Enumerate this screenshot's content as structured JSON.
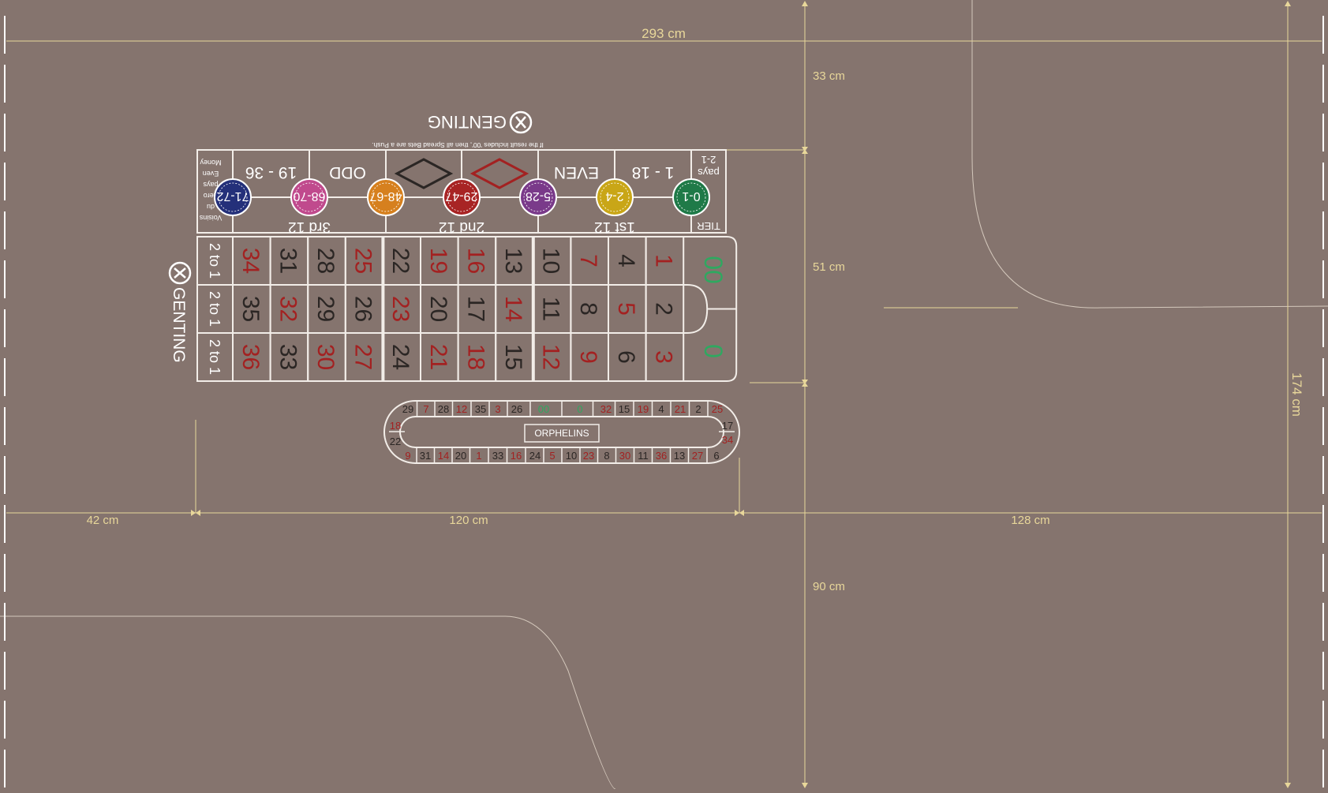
{
  "colors": {
    "felt": "#85746e",
    "line": "#f2ede8",
    "dim": "#e8d79a",
    "red": "#a32121",
    "black": "#2b2624",
    "green": "#2fa860"
  },
  "dimensions": {
    "width_total": "293 cm",
    "height_total": "174 cm",
    "top_margin": "33 cm",
    "layout_height": "51 cm",
    "bottom_margin": "90 cm",
    "left_margin": "42 cm",
    "layout_width": "120 cm",
    "right_margin": "128 cm"
  },
  "brand": {
    "name": "GENTING",
    "logo_icon": "genting-logo-icon",
    "notice": "If the result includes '00', then all Spread Bets are a Push."
  },
  "columns": {
    "label": "2 to 1",
    "rows": [
      [
        34,
        31,
        28,
        25,
        22,
        19,
        16,
        13,
        10,
        7,
        4,
        1
      ],
      [
        35,
        32,
        29,
        26,
        23,
        20,
        17,
        14,
        11,
        8,
        5,
        2
      ],
      [
        36,
        33,
        30,
        27,
        24,
        21,
        18,
        15,
        12,
        9,
        6,
        3
      ]
    ]
  },
  "red_numbers": [
    1,
    3,
    5,
    7,
    9,
    12,
    14,
    16,
    18,
    19,
    21,
    23,
    25,
    27,
    30,
    32,
    34,
    36
  ],
  "zeros": {
    "double_zero": "00",
    "zero": "0"
  },
  "outside": {
    "dozens": [
      "3rd 12",
      "2nd 12",
      "1st 12"
    ],
    "even_money": [
      "19 - 36",
      "ODD",
      "",
      "",
      "EVEN",
      "1 - 18"
    ],
    "tier": "TIER",
    "pays": "pays",
    "pays_value": "2-1",
    "money_lines": [
      "Money",
      "Even",
      "pays",
      "Zero",
      "du",
      "Voisins"
    ]
  },
  "spread_chips": [
    {
      "label": "71-72",
      "color": "#24307a"
    },
    {
      "label": "68-70",
      "color": "#c04a8d"
    },
    {
      "label": "48-67",
      "color": "#d6801e"
    },
    {
      "label": "29-47",
      "color": "#a82424"
    },
    {
      "label": "5-28",
      "color": "#7a3a8a"
    },
    {
      "label": "2-4",
      "color": "#c9a617"
    },
    {
      "label": "0-1",
      "color": "#1f7a48"
    }
  ],
  "racetrack": {
    "label": "ORPHELINS",
    "top": [
      "29",
      "7",
      "28",
      "12",
      "35",
      "3",
      "26",
      "00",
      "0",
      "32",
      "15",
      "19",
      "4",
      "21",
      "2",
      "25"
    ],
    "bottom": [
      "9",
      "31",
      "14",
      "20",
      "1",
      "33",
      "16",
      "24",
      "5",
      "10",
      "23",
      "8",
      "30",
      "11",
      "36",
      "13",
      "27",
      "6"
    ],
    "left": [
      "18",
      "22"
    ],
    "right": [
      "17",
      "34"
    ]
  }
}
